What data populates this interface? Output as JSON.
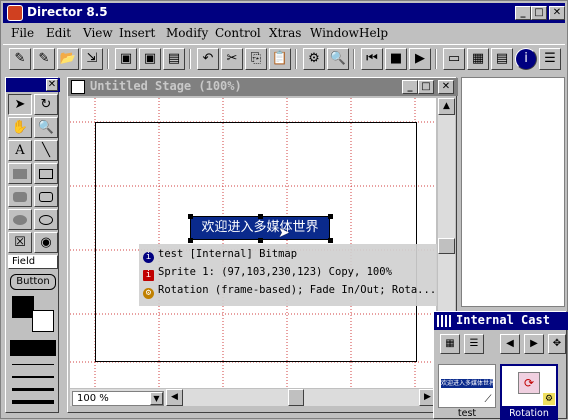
{
  "window": {
    "title": "Director 8.5",
    "min_label": "_",
    "max_label": "□",
    "close_label": "✕"
  },
  "menu": [
    "File",
    "Edit",
    "View",
    "Insert",
    "Modify",
    "Control",
    "Xtras",
    "Window",
    "Help"
  ],
  "toolbar_icons": [
    "new-movie-icon",
    "new-cast-icon",
    "open-icon",
    "import-icon",
    "save-icon",
    "save-all-icon",
    "print-icon",
    "undo-icon",
    "cut-icon",
    "copy-icon",
    "paste-icon",
    "find-icon",
    "search-icon",
    "rewind-icon",
    "stop-icon",
    "play-icon",
    "stage-icon",
    "score-icon",
    "cast-icon",
    "info-icon",
    "library-icon"
  ],
  "tool_palette": {
    "field_label": "Field",
    "button_label": "Button"
  },
  "stage": {
    "title": "Untitled Stage (100%)",
    "zoom": "100 %",
    "banner_text": "欢迎进入多媒体世界"
  },
  "sprite_overlay": {
    "line1": "test [Internal] Bitmap",
    "line2": "Sprite 1: (97,103,230,123) Copy, 100%",
    "line3": "Rotation (frame-based); Fade In/Out; Rota...",
    "colors": {
      "info": "#000080",
      "sprite": "#c00000",
      "behavior": "#c08000"
    }
  },
  "cast": {
    "title": "Internal Cast",
    "members": [
      {
        "label": "test",
        "thumb_text": "欢迎进入多媒体世界"
      },
      {
        "label": "Rotation",
        "thumb_text": ""
      }
    ]
  }
}
